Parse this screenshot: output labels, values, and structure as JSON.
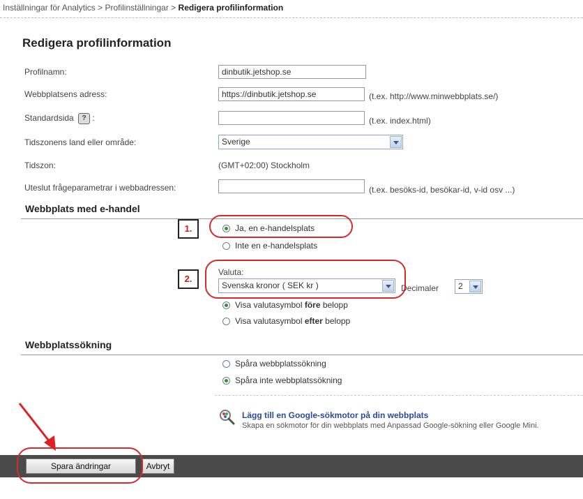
{
  "breadcrumb": {
    "part1": "Inställningar för Analytics",
    "sep1": ">",
    "part2": "Profilinställningar",
    "sep2": ">",
    "current": "Redigera profilinformation"
  },
  "page_title": "Redigera profilinformation",
  "form": {
    "profile_name": {
      "label": "Profilnamn:",
      "value": "dinbutik.jetshop.se"
    },
    "website_url": {
      "label": "Webbplatsens adress:",
      "value": "https://dinbutik.jetshop.se",
      "hint": "(t.ex. http://www.minwebbplats.se/)"
    },
    "default_page": {
      "label": "Standardsida",
      "help": "?",
      "colon": ":",
      "value": "",
      "hint": "(t.ex. index.html)"
    },
    "timezone_country": {
      "label": "Tidszonens land eller område:",
      "value": "Sverige"
    },
    "timezone": {
      "label": "Tidszon:",
      "value": "(GMT+02:00) Stockholm"
    },
    "exclude_params": {
      "label": "Uteslut frågeparametrar i webbadressen:",
      "value": "",
      "hint": "(t.ex. besöks-id, besökar-id, v-id osv ...)"
    }
  },
  "ecommerce": {
    "heading": "Webbplats med e-handel",
    "option_yes": "Ja, en e-handelsplats",
    "option_no": "Inte en e-handelsplats",
    "currency_label": "Valuta:",
    "currency_value": "Svenska kronor ( SEK kr )",
    "decimals_label": "Decimaler",
    "decimals_value": "2",
    "symbol_before": {
      "pre": "Visa valutasymbol ",
      "bold": "före",
      "post": " belopp"
    },
    "symbol_after": {
      "pre": "Visa valutasymbol ",
      "bold": "efter",
      "post": " belopp"
    }
  },
  "site_search": {
    "heading": "Webbplatssökning",
    "option_track": "Spåra webbplatssökning",
    "option_no_track": "Spåra inte webbplatssökning",
    "google_link": "Lägg till en Google-sökmotor på din webbplats",
    "google_desc": "Skapa en sökmotor för din webbplats med Anpassad Google-sökning eller Google Mini."
  },
  "annotations": {
    "marker1": "1.",
    "marker2": "2."
  },
  "buttons": {
    "save": "Spara ändringar",
    "cancel": "Avbryt"
  },
  "colors": {
    "annotation_red": "#d42a2a",
    "footer_bar": "#4a4a4a",
    "radio_selected": "#3a8f2a",
    "link_blue": "#2a4a9a"
  }
}
